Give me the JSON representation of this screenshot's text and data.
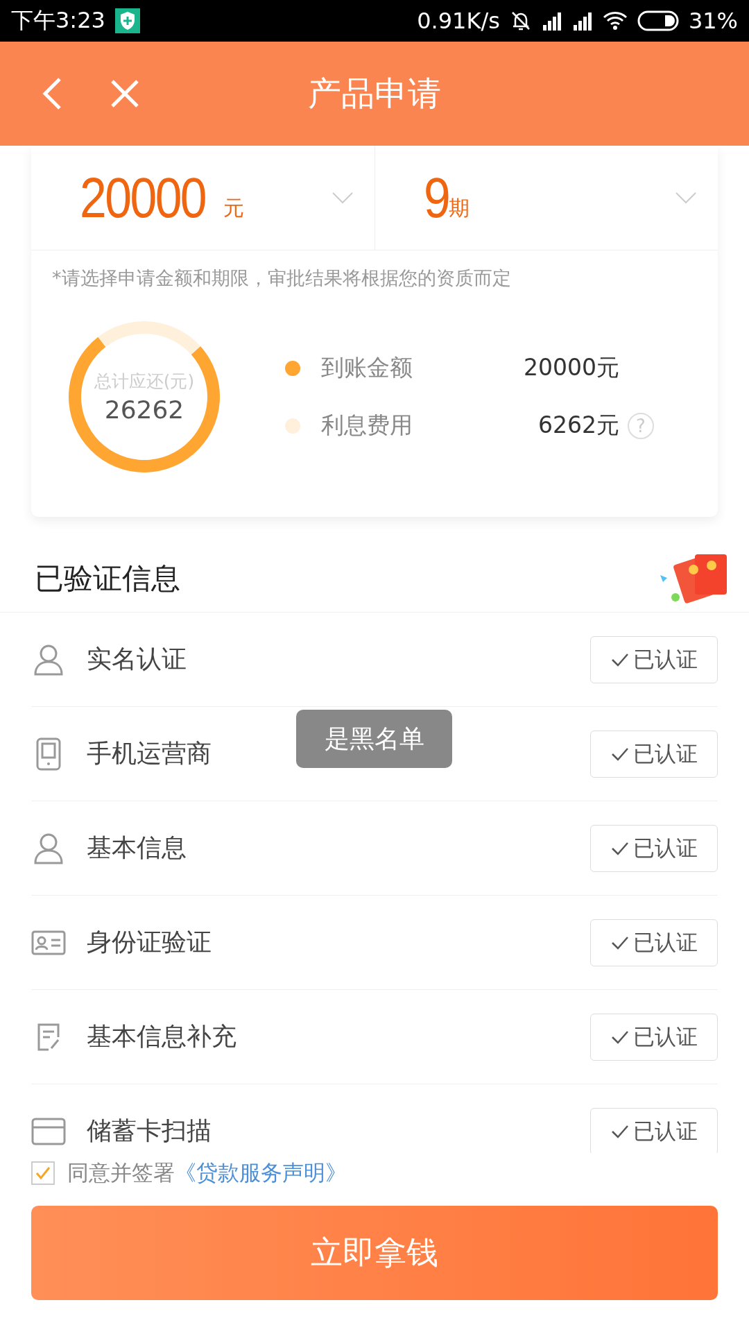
{
  "status_bar": {
    "time": "下午3:23",
    "speed": "0.91K/s",
    "battery": "31%"
  },
  "header": {
    "title": "产品申请"
  },
  "selectors": [
    {
      "value": "20000",
      "unit": "元"
    },
    {
      "value": "9",
      "unit": "期"
    }
  ],
  "note": "*请选择申请金额和期限，审批结果将根据您的资质而定",
  "summary": {
    "center_label": "总计应还(元)",
    "center_value": "26262",
    "chart_data": {
      "type": "donut",
      "categories": [
        "到账金额",
        "利息费用"
      ],
      "values": [
        76.2,
        23.8
      ],
      "legend": "right"
    },
    "legend": [
      {
        "amount": "20000元",
        "color": "#ffa531"
      },
      {
        "amount": "6262元",
        "color": "#fff0dc",
        "help_icon": "?"
      }
    ]
  },
  "section": {
    "title": "已验证信息"
  },
  "items": [
    {
      "kind": "person",
      "label": "实名认证",
      "status": "已认证"
    },
    {
      "kind": "phone",
      "label": "手机运营商",
      "status": "已认证"
    },
    {
      "kind": "person",
      "label": "基本信息",
      "status": "已认证"
    },
    {
      "kind": "idcard",
      "label": "身份证验证",
      "status": "已认证"
    },
    {
      "kind": "form",
      "label": "基本信息补充",
      "status": "已认证"
    },
    {
      "kind": "card",
      "label": "储蓄卡扫描",
      "status": "已认证"
    }
  ],
  "toast": "是黑名单",
  "agreement": {
    "checked": true,
    "text": "同意并签署",
    "link": "《贷款服务声明》"
  },
  "submit": "立即拿钱"
}
